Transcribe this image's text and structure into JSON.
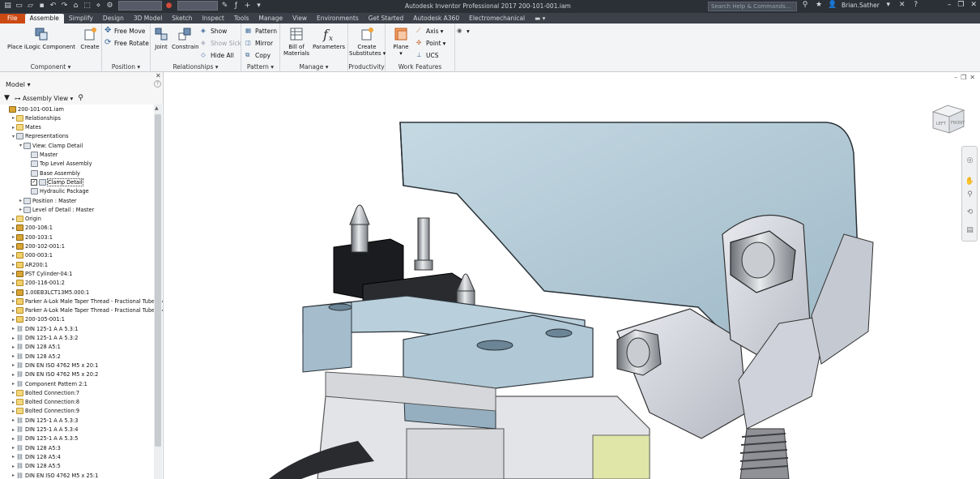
{
  "app": {
    "window_title": "Autodesk Inventor Professional 2017   200-101-001.iam",
    "search_placeholder": "Search Help & Commands...",
    "user_name": "Brian.Sather",
    "colors": {
      "file_tab": "#cc4a12",
      "title_bar": "#2b2f36",
      "tab_bar": "#3b4049",
      "ribbon": "#f3f4f6",
      "model_blue": "#b4ccd8"
    }
  },
  "tabs": [
    "File",
    "Assemble",
    "Simplify",
    "Design",
    "3D Model",
    "Sketch",
    "Inspect",
    "Tools",
    "Manage",
    "View",
    "Environments",
    "Get Started",
    "Autodesk A360",
    "Electromechanical"
  ],
  "active_tab": "Assemble",
  "ribbon": {
    "component": {
      "label": "Component",
      "place": "Place iLogic Component",
      "create": "Create"
    },
    "position": {
      "label": "Position",
      "free_move": "Free Move",
      "free_rotate": "Free Rotate"
    },
    "relationships": {
      "label": "Relationships",
      "joint": "Joint",
      "constrain": "Constrain",
      "show": "Show",
      "show_sick": "Show Sick",
      "hide_all": "Hide All"
    },
    "pattern": {
      "label": "Pattern",
      "pattern": "Pattern",
      "mirror": "Mirror",
      "copy": "Copy"
    },
    "manage": {
      "label": "Manage",
      "bom_line1": "Bill of",
      "bom_line2": "Materials",
      "parameters": "Parameters"
    },
    "productivity": {
      "label": "Productivity",
      "create_sub_line1": "Create",
      "create_sub_line2": "Substitutes"
    },
    "work_features": {
      "label": "Work Features",
      "plane": "Plane",
      "axis": "Axis",
      "point": "Point",
      "ucs": "UCS"
    }
  },
  "browser": {
    "title": "Model",
    "view_mode": "Assembly View",
    "tree": [
      {
        "label": "200-101-001.iam",
        "level": 0,
        "icon": "asm",
        "twisty": ""
      },
      {
        "label": "Relationships",
        "level": 1,
        "icon": "folder",
        "twisty": "▸"
      },
      {
        "label": "Mates",
        "level": 1,
        "icon": "folder",
        "twisty": "▸"
      },
      {
        "label": "Representations",
        "level": 1,
        "icon": "rep",
        "twisty": "▾"
      },
      {
        "label": "View: Clamp Detail",
        "level": 2,
        "icon": "rep",
        "twisty": "▾"
      },
      {
        "label": "Master",
        "level": 3,
        "icon": "rep",
        "twisty": ""
      },
      {
        "label": "Top Level Assembly",
        "level": 3,
        "icon": "rep",
        "twisty": ""
      },
      {
        "label": "Base Assembly",
        "level": 3,
        "icon": "rep",
        "twisty": ""
      },
      {
        "label": "Clamp Detail",
        "level": 3,
        "icon": "rep",
        "twisty": "",
        "checked": true,
        "selected": true
      },
      {
        "label": "Hydraulic Package",
        "level": 3,
        "icon": "rep",
        "twisty": ""
      },
      {
        "label": "Position : Master",
        "level": 2,
        "icon": "rep",
        "twisty": "▸"
      },
      {
        "label": "Level of Detail : Master",
        "level": 2,
        "icon": "rep",
        "twisty": "▸"
      },
      {
        "label": "Origin",
        "level": 1,
        "icon": "folder",
        "twisty": "▸"
      },
      {
        "label": "200-106:1",
        "level": 1,
        "icon": "asm",
        "twisty": "▸"
      },
      {
        "label": "200-103:1",
        "level": 1,
        "icon": "asm",
        "twisty": "▸"
      },
      {
        "label": "200-102-001:1",
        "level": 1,
        "icon": "asm",
        "twisty": "▸"
      },
      {
        "label": "000-003:1",
        "level": 1,
        "icon": "part",
        "twisty": "▸"
      },
      {
        "label": "AR200:1",
        "level": 1,
        "icon": "part",
        "twisty": "▸"
      },
      {
        "label": "PST Cylinder-04:1",
        "level": 1,
        "icon": "asm",
        "twisty": "▸"
      },
      {
        "label": "200-116-001:2",
        "level": 1,
        "icon": "part",
        "twisty": "▸"
      },
      {
        "label": "1.00EB3LCT13M5.000:1",
        "level": 1,
        "icon": "asm",
        "twisty": "▸"
      },
      {
        "label": "Parker A-Lok Male Taper Thread - Fractional Tube 1/4",
        "level": 1,
        "icon": "part",
        "twisty": "▸"
      },
      {
        "label": "Parker A-Lok Male Taper Thread - Fractional Tube 1/4",
        "level": 1,
        "icon": "part",
        "twisty": "▸"
      },
      {
        "label": "200-105-001:1",
        "level": 1,
        "icon": "part",
        "twisty": "▸"
      },
      {
        "label": "DIN 125-1 A A 5.3:1",
        "level": 1,
        "icon": "con",
        "twisty": "▸"
      },
      {
        "label": "DIN 125-1 A A 5.3:2",
        "level": 1,
        "icon": "con",
        "twisty": "▸"
      },
      {
        "label": "DIN 128 A5:1",
        "level": 1,
        "icon": "con",
        "twisty": "▸"
      },
      {
        "label": "DIN 128 A5:2",
        "level": 1,
        "icon": "con",
        "twisty": "▸"
      },
      {
        "label": "DIN EN ISO 4762 M5 x 20:1",
        "level": 1,
        "icon": "con",
        "twisty": "▸"
      },
      {
        "label": "DIN EN ISO 4762 M5 x 20:2",
        "level": 1,
        "icon": "con",
        "twisty": "▸"
      },
      {
        "label": "Component Pattern 2:1",
        "level": 1,
        "icon": "con",
        "twisty": "▸"
      },
      {
        "label": "Bolted Connection:7",
        "level": 1,
        "icon": "folder",
        "twisty": "▸"
      },
      {
        "label": "Bolted Connection:8",
        "level": 1,
        "icon": "folder",
        "twisty": "▸"
      },
      {
        "label": "Bolted Connection:9",
        "level": 1,
        "icon": "folder",
        "twisty": "▸"
      },
      {
        "label": "DIN 125-1 A A 5.3:3",
        "level": 1,
        "icon": "con",
        "twisty": "▸"
      },
      {
        "label": "DIN 125-1 A A 5.3:4",
        "level": 1,
        "icon": "con",
        "twisty": "▸"
      },
      {
        "label": "DIN 125-1 A A 5.3:5",
        "level": 1,
        "icon": "con",
        "twisty": "▸"
      },
      {
        "label": "DIN 128 A5:3",
        "level": 1,
        "icon": "con",
        "twisty": "▸"
      },
      {
        "label": "DIN 128 A5:4",
        "level": 1,
        "icon": "con",
        "twisty": "▸"
      },
      {
        "label": "DIN 128 A5:5",
        "level": 1,
        "icon": "con",
        "twisty": "▸"
      },
      {
        "label": "DIN EN ISO 4762 M5 x 25:1",
        "level": 1,
        "icon": "con",
        "twisty": "▸"
      }
    ]
  },
  "viewcube": {
    "left": "LEFT",
    "front": "FRONT"
  }
}
